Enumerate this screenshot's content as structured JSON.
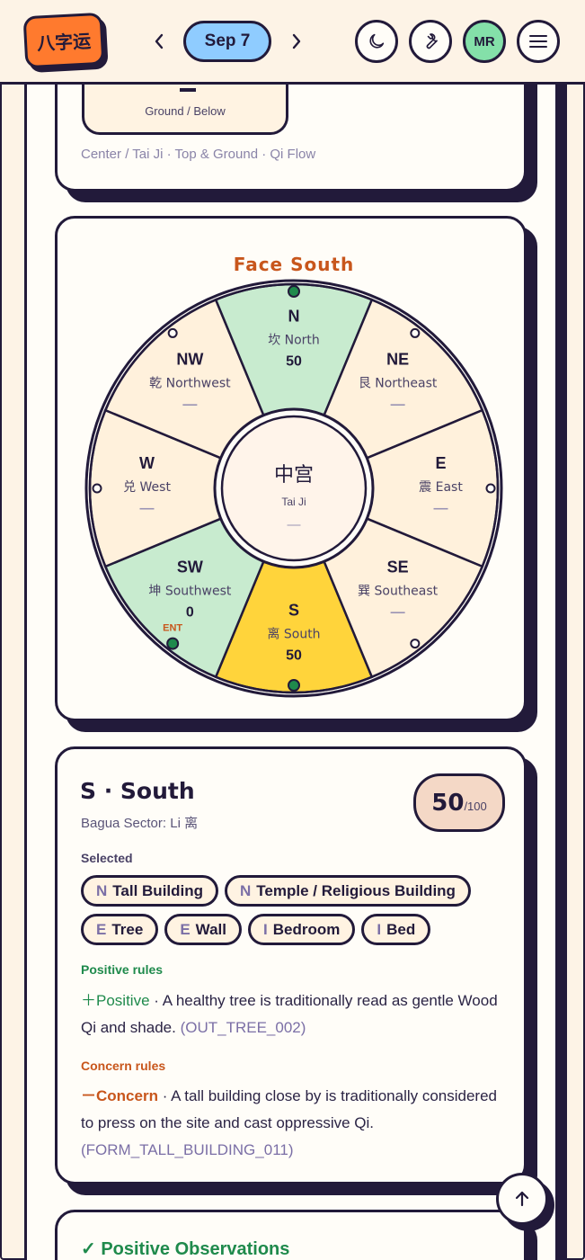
{
  "header": {
    "logo_text": "八字运",
    "date": "Sep 7",
    "prev_icon": "chevron-left-icon",
    "next_icon": "chevron-right-icon",
    "avatar_initials": "MR",
    "buttons": [
      "moon-icon",
      "wrench-icon",
      "avatar",
      "menu-icon"
    ]
  },
  "ground_card": {
    "label": "Ground / Below",
    "symbol": "—",
    "footer": "Center / Tai Ji · Top & Ground · Qi Flow"
  },
  "compass": {
    "facing_label": "Face South",
    "entrance_label": "ENT",
    "center": {
      "title": "中宫",
      "subtitle": "Tai Ji",
      "score": "—"
    },
    "sectors": [
      {
        "code": "S",
        "name": "离 South",
        "score": "50",
        "fill": "#ffd43b"
      },
      {
        "code": "SW",
        "name": "坤 Southwest",
        "score": "0",
        "fill": "#c8ebcf"
      },
      {
        "code": "W",
        "name": "兑 West",
        "score": "—",
        "fill": "#fff1dc"
      },
      {
        "code": "NW",
        "name": "乾 Northwest",
        "score": "—",
        "fill": "#fff1dc"
      },
      {
        "code": "N",
        "name": "坎 North",
        "score": "50",
        "fill": "#c8ebcf"
      },
      {
        "code": "NE",
        "name": "艮 Northeast",
        "score": "—",
        "fill": "#fff1dc"
      },
      {
        "code": "E",
        "name": "震 East",
        "score": "—",
        "fill": "#fff1dc"
      },
      {
        "code": "SE",
        "name": "巽 Southeast",
        "score": "—",
        "fill": "#fff1dc"
      }
    ],
    "colors": {
      "ink": "#221a3a",
      "accent": "#c8561c",
      "marker": "#1f8a4c"
    }
  },
  "sector_detail": {
    "title": "S · South",
    "subtitle": "Bagua Sector: Li 离",
    "score": "50",
    "score_max": "/100",
    "selected_label": "Selected",
    "chips": [
      {
        "tag": "N",
        "label": "Tall Building"
      },
      {
        "tag": "N",
        "label": "Temple / Religious Building"
      },
      {
        "tag": "E",
        "label": "Tree"
      },
      {
        "tag": "E",
        "label": "Wall"
      },
      {
        "tag": "I",
        "label": "Bedroom"
      },
      {
        "tag": "I",
        "label": "Bed"
      }
    ],
    "positive_heading": "Positive rules",
    "positive_kind": "＋Positive",
    "positive_text": " · A healthy tree is traditionally read as gentle Wood Qi and shade. ",
    "positive_code": "(OUT_TREE_002)",
    "concern_heading": "Concern rules",
    "concern_kind": "－Concern",
    "concern_text": " · A tall building close by is traditionally considered to press on the site and cast oppressive Qi. ",
    "concern_code": "(FORM_TALL_BUILDING_011)"
  },
  "observations": {
    "positive_title": "✓ Positive Observations"
  }
}
